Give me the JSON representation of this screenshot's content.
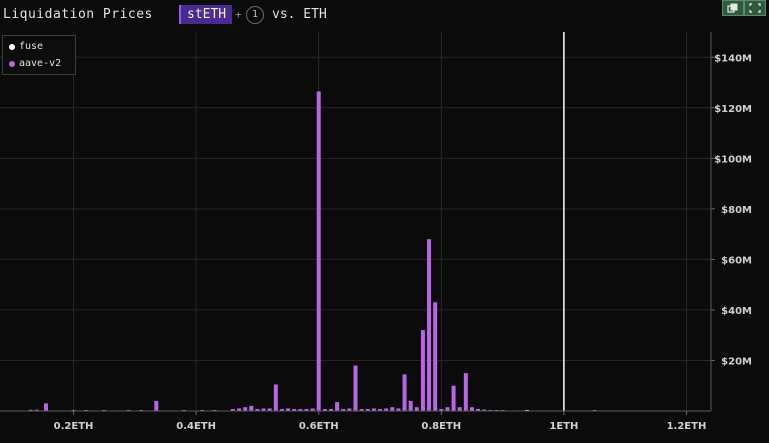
{
  "header": {
    "title": "Liquidation Prices",
    "asset": "stETH",
    "plus": "+",
    "extra_count": "1",
    "vs": "vs. ETH"
  },
  "window_controls": [
    {
      "icon": "copy-icon"
    },
    {
      "icon": "expand-icon"
    }
  ],
  "colors": {
    "background": "#0b0b0c",
    "fuse": "#ffffff",
    "aave_v2": "#b866e6",
    "grid": "#262626",
    "marker": "#ffffff"
  },
  "chart_data": {
    "type": "bar",
    "xlabel": "",
    "ylabel": "",
    "x_unit": "ETH",
    "xlim": [
      0.08,
      1.24
    ],
    "ylim": [
      0,
      150000000
    ],
    "x_ticks": [
      {
        "value": 0.2,
        "label": "0.2ETH"
      },
      {
        "value": 0.4,
        "label": "0.4ETH"
      },
      {
        "value": 0.6,
        "label": "0.6ETH"
      },
      {
        "value": 0.8,
        "label": "0.8ETH"
      },
      {
        "value": 1.0,
        "label": "1ETH"
      },
      {
        "value": 1.2,
        "label": "1.2ETH"
      }
    ],
    "y_ticks": [
      {
        "value": 20000000,
        "label": "$20M"
      },
      {
        "value": 40000000,
        "label": "$40M"
      },
      {
        "value": 60000000,
        "label": "$60M"
      },
      {
        "value": 80000000,
        "label": "$80M"
      },
      {
        "value": 100000000,
        "label": "$100M"
      },
      {
        "value": 120000000,
        "label": "$120M"
      },
      {
        "value": 140000000,
        "label": "$140M"
      }
    ],
    "marker_x": 1.0,
    "grid": true,
    "legend": "top-left",
    "series": [
      {
        "name": "fuse",
        "x": [
          0.94
        ],
        "values": [
          400000
        ]
      },
      {
        "name": "aave-v2",
        "x": [
          0.13,
          0.14,
          0.155,
          0.2,
          0.22,
          0.25,
          0.29,
          0.31,
          0.335,
          0.38,
          0.41,
          0.43,
          0.46,
          0.47,
          0.48,
          0.49,
          0.5,
          0.51,
          0.52,
          0.53,
          0.54,
          0.55,
          0.56,
          0.57,
          0.58,
          0.59,
          0.6,
          0.61,
          0.62,
          0.63,
          0.64,
          0.65,
          0.66,
          0.67,
          0.68,
          0.69,
          0.7,
          0.71,
          0.72,
          0.73,
          0.74,
          0.75,
          0.76,
          0.77,
          0.78,
          0.79,
          0.8,
          0.81,
          0.82,
          0.83,
          0.84,
          0.85,
          0.86,
          0.87,
          0.88,
          0.89,
          0.9,
          1.05
        ],
        "values": [
          500000,
          500000,
          3000000,
          400000,
          400000,
          400000,
          400000,
          400000,
          4000000,
          400000,
          400000,
          400000,
          800000,
          1000000,
          1500000,
          2000000,
          800000,
          1000000,
          1000000,
          10500000,
          800000,
          1000000,
          800000,
          800000,
          800000,
          1000000,
          126500000,
          800000,
          800000,
          3500000,
          800000,
          1000000,
          18000000,
          800000,
          800000,
          1000000,
          800000,
          1000000,
          1500000,
          1000000,
          14500000,
          4000000,
          1500000,
          32000000,
          68000000,
          43000000,
          800000,
          1500000,
          10000000,
          1500000,
          15000000,
          1500000,
          800000,
          600000,
          400000,
          400000,
          400000,
          400000
        ]
      }
    ]
  }
}
